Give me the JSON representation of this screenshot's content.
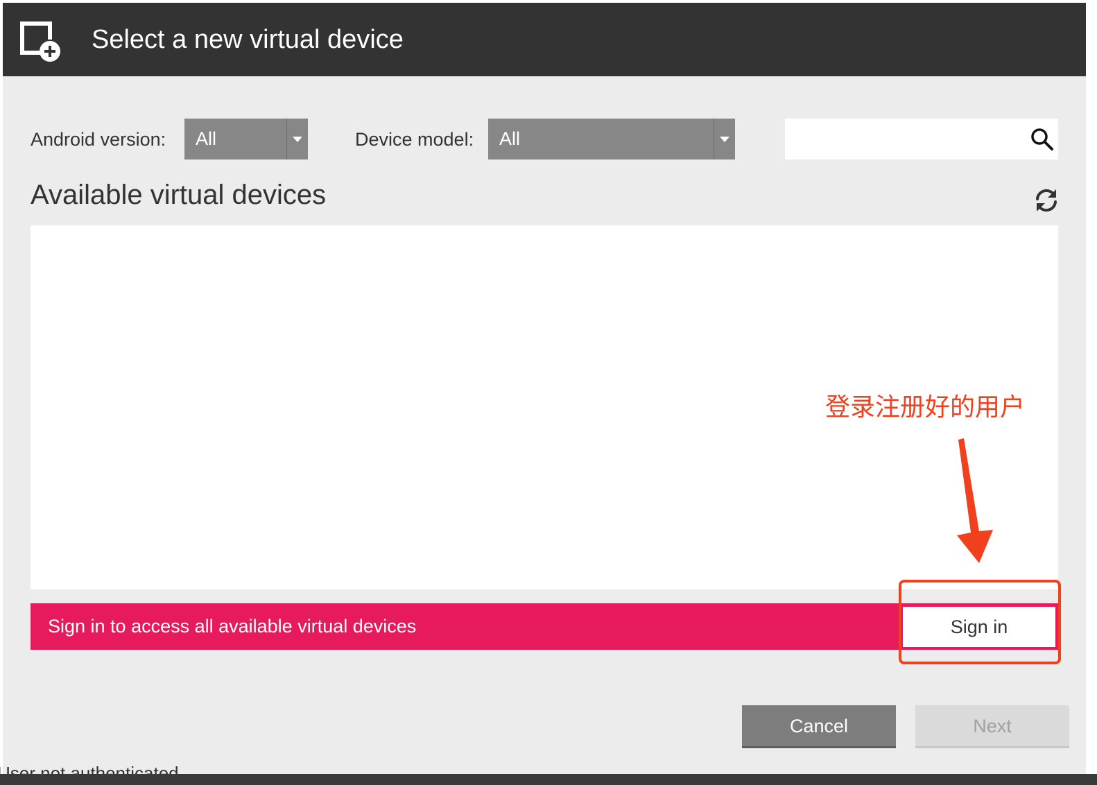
{
  "dialog": {
    "title": "Select a new virtual device",
    "title_icon": "add-device-icon"
  },
  "filters": {
    "android_version_label": "Android version:",
    "android_version_value": "All",
    "device_model_label": "Device model:",
    "device_model_value": "All",
    "search_placeholder": "",
    "search_icon": "search-icon"
  },
  "list": {
    "title": "Available virtual devices",
    "refresh_icon": "refresh-icon",
    "items": []
  },
  "banner": {
    "text": "Sign in to access all available virtual devices",
    "signin_label": "Sign in",
    "color": "#e61a5c"
  },
  "annotation": {
    "text": "登录注册好的用户",
    "color": "#f0401e"
  },
  "footer": {
    "cancel_label": "Cancel",
    "next_label": "Next"
  },
  "status": {
    "text": "User not authenticated"
  }
}
